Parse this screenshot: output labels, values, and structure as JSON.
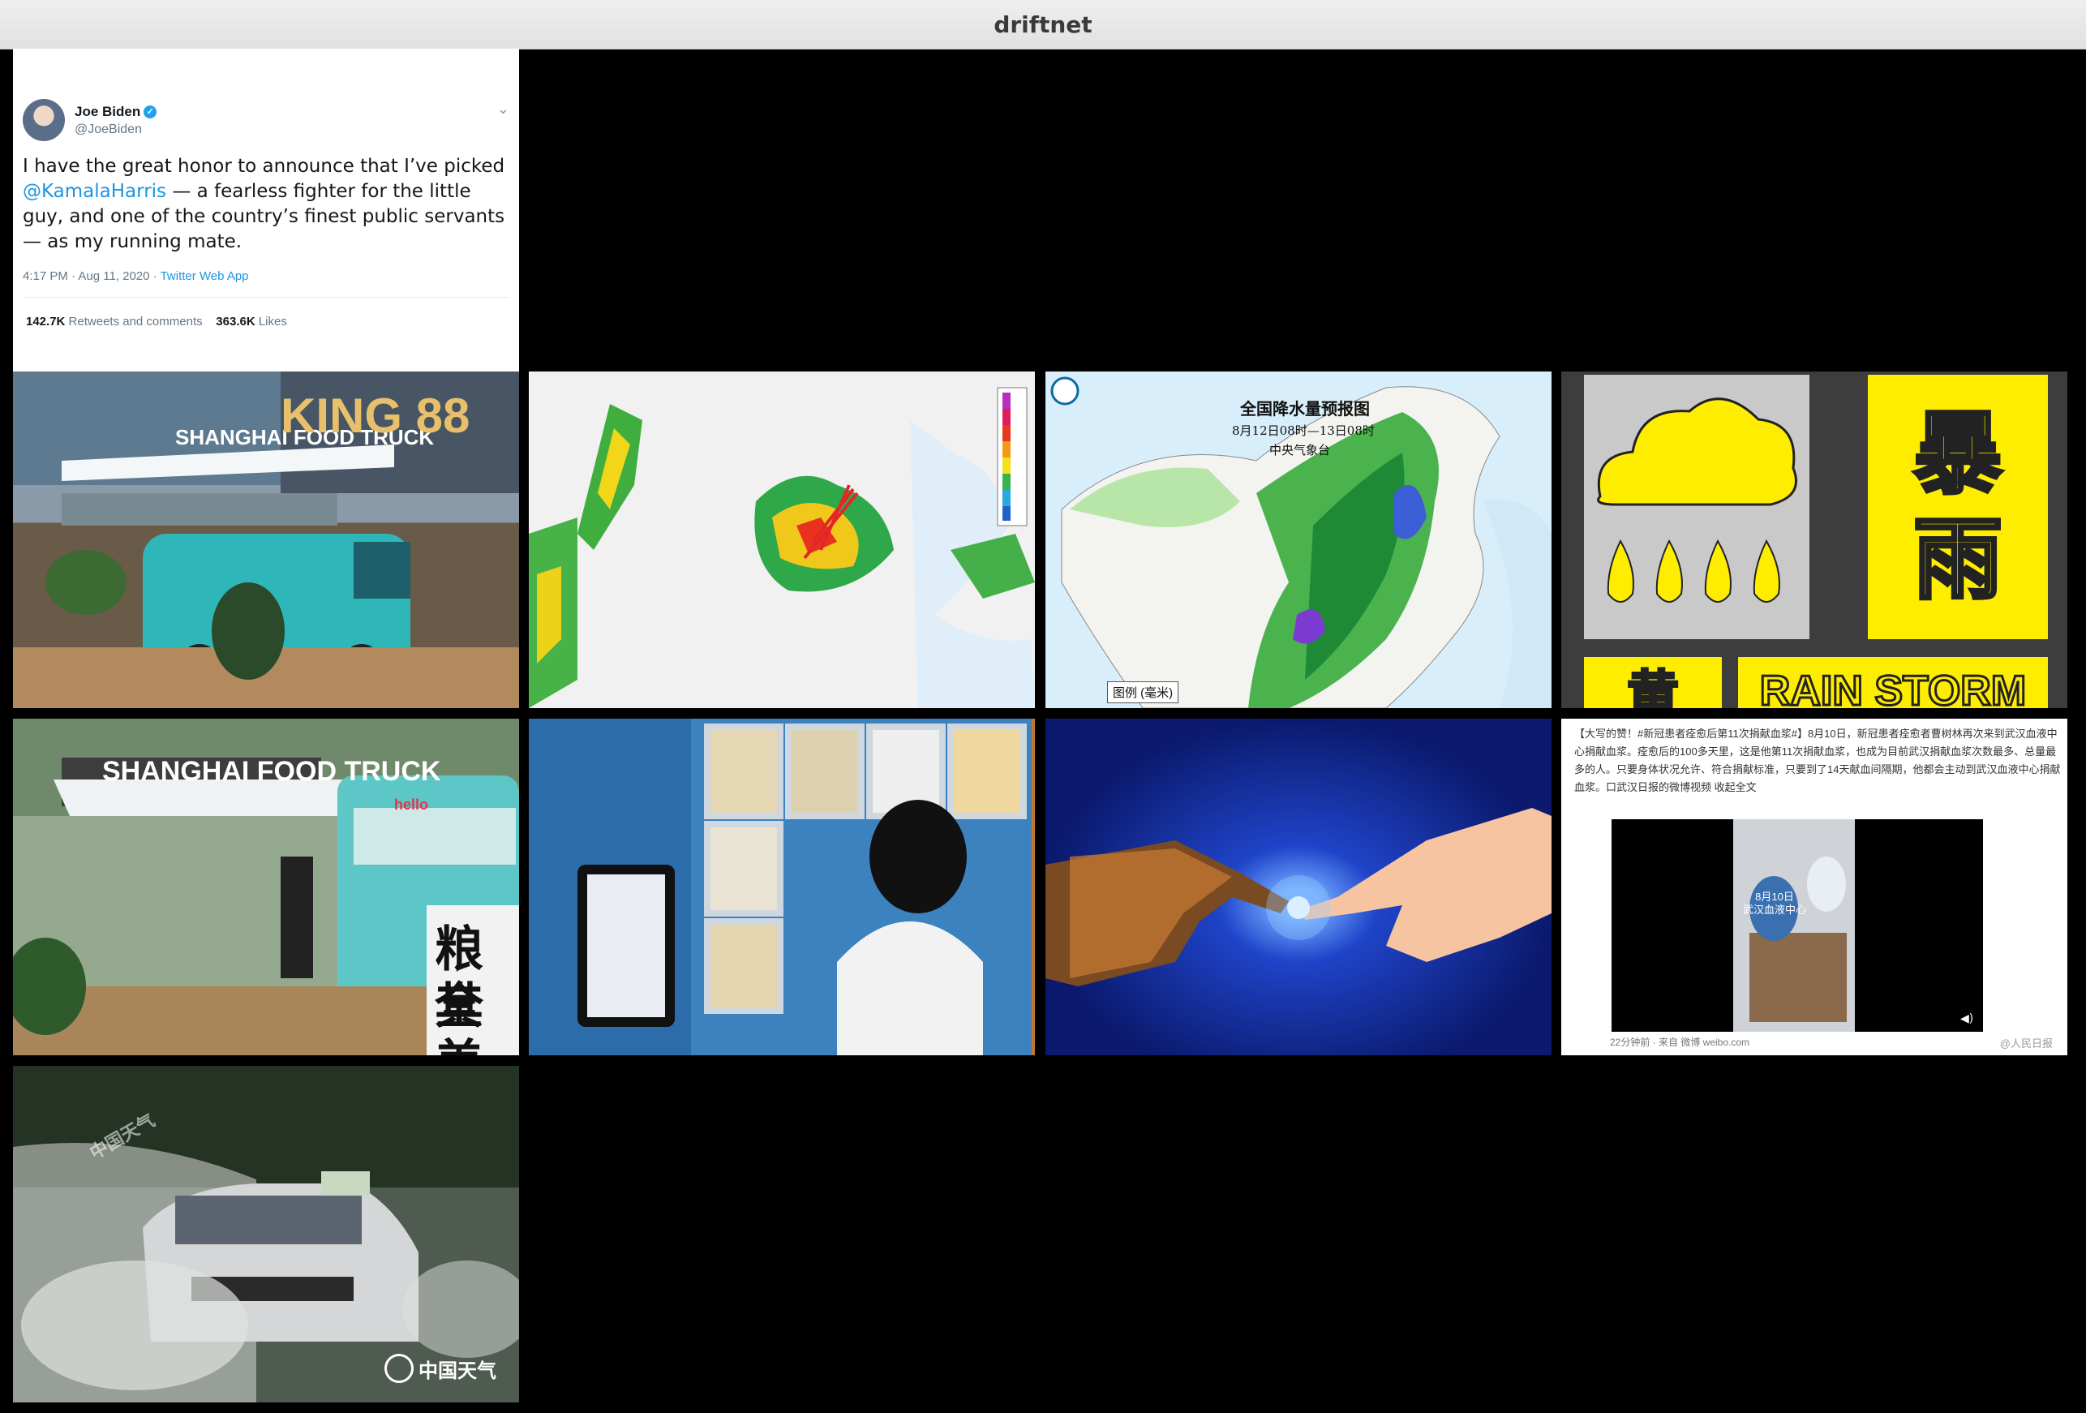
{
  "window": {
    "title": "driftnet"
  },
  "tweet": {
    "name": "Joe Biden",
    "handle": "@JoeBiden",
    "text_before": "I have the great honor to announce that I’ve picked ",
    "mention": "@KamalaHarris",
    "text_after": " — a fearless fighter for the little guy, and one of the country’s finest public servants — as my running mate.",
    "time": "4:17 PM · Aug 11, 2020 · ",
    "app": "Twitter Web App",
    "retweets_count": "142.7K",
    "retweets_label": "Retweets and comments",
    "likes_count": "363.6K",
    "likes_label": "Likes"
  },
  "food_truck_1": {
    "sign": "SHANGHAI FOOD TRUCK",
    "building": "KING 88"
  },
  "rain_map": {
    "title": "全国降水量预报图",
    "subtitle": "8月12日08时—13日08时",
    "org": "中央气象台",
    "legend": "图例 (毫米)"
  },
  "rain_warning": {
    "char_top": "暴",
    "char_bottom": "雨",
    "color_char": "黄",
    "english": "RAIN STORM"
  },
  "food_truck_2": {
    "sign": "SHANGHAI FOOD TRUCK",
    "brand": "hello",
    "side_text_1": "粮全",
    "side_text_2": "其美"
  },
  "weibo": {
    "post": "【大写的赞！#新冠患者痊愈后第11次捐献血浆#】8月10日，新冠患者痊愈者曹树林再次来到武汉血液中心捐献血浆。痊愈后的100多天里，这是他第11次捐献血浆，也成为目前武汉捐献血浆次数最多、总量最多的人。只要身体状况允许、符合捐献标准，只要到了14天献血间隔期，他都会主动到武汉血液中心捐献血浆。口武汉日报的微博视频 收起全文",
    "video_caption_1": "8月10日",
    "video_caption_2": "武汉血液中心",
    "footer": "22分钟前 · 来自 微博 weibo.com",
    "watermark": "@人民日报"
  },
  "car_photo": {
    "watermark": "中国天气",
    "wm_faint": "中国天气"
  }
}
